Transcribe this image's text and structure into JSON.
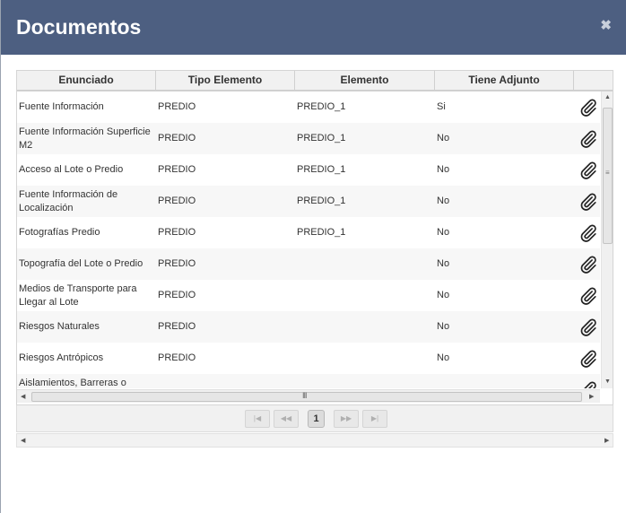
{
  "dialog": {
    "title": "Documentos",
    "close_glyph": "✖"
  },
  "table": {
    "columns": [
      "Enunciado",
      "Tipo Elemento",
      "Elemento",
      "Tiene Adjunto"
    ],
    "rows": [
      {
        "enunciado": "Fuente Información",
        "tipo": "PREDIO",
        "elemento": "PREDIO_1",
        "adjunto": "Si"
      },
      {
        "enunciado": "Fuente Información Superficie M2",
        "tipo": "PREDIO",
        "elemento": "PREDIO_1",
        "adjunto": "No"
      },
      {
        "enunciado": "Acceso al Lote o Predio",
        "tipo": "PREDIO",
        "elemento": "PREDIO_1",
        "adjunto": "No"
      },
      {
        "enunciado": "Fuente Información de Localización",
        "tipo": "PREDIO",
        "elemento": "PREDIO_1",
        "adjunto": "No"
      },
      {
        "enunciado": "Fotografías Predio",
        "tipo": "PREDIO",
        "elemento": "PREDIO_1",
        "adjunto": "No"
      },
      {
        "enunciado": "Topografía del Lote o Predio",
        "tipo": "PREDIO",
        "elemento": "",
        "adjunto": "No"
      },
      {
        "enunciado": "Medios de Transporte para Llegar al Lote",
        "tipo": "PREDIO",
        "elemento": "",
        "adjunto": "No"
      },
      {
        "enunciado": "Riesgos Naturales",
        "tipo": "PREDIO",
        "elemento": "",
        "adjunto": "No"
      },
      {
        "enunciado": "Riesgos Antrópicos",
        "tipo": "PREDIO",
        "elemento": "",
        "adjunto": "No"
      },
      {
        "enunciado": "Aislamientos, Barreras o retiros",
        "tipo": "",
        "elemento": "",
        "adjunto": ""
      }
    ],
    "attachment_icon": "paperclip-icon"
  },
  "pager": {
    "current_page": "1",
    "first": "|◀",
    "prev": "◀◀",
    "next": "▶▶",
    "last": "▶|"
  },
  "scroll": {
    "up": "▲",
    "down": "▼",
    "left": "◀",
    "right": "▶",
    "vgrip": "≡",
    "hgrip": "III"
  },
  "colors": {
    "titlebar": "#4d5f81",
    "header": "#f1f1f1"
  }
}
